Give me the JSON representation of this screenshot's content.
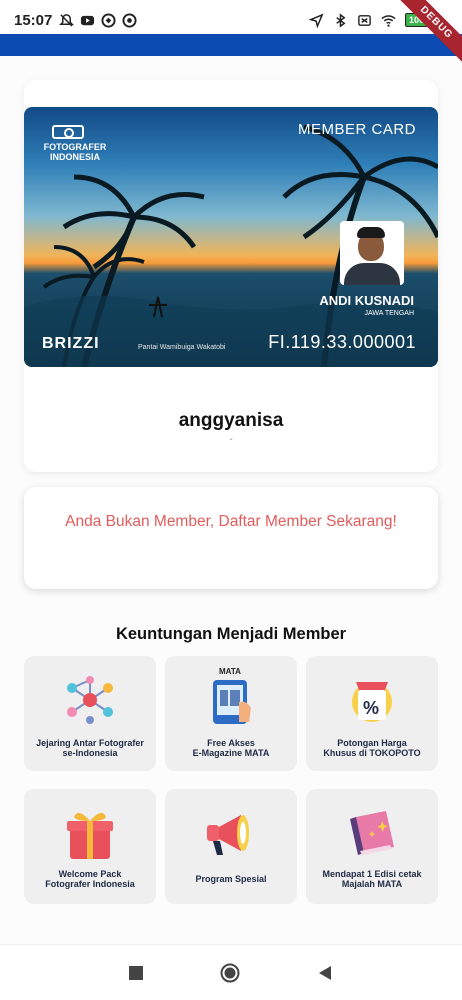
{
  "status_bar": {
    "time": "15:07",
    "battery": "100"
  },
  "debug_ribbon": "DEBUG",
  "member_card": {
    "org_logo": "FOTOGRAFER INDONESIA",
    "title": "MEMBER CARD",
    "holder_name": "ANDI KUSNADI",
    "holder_region": "JAWA TENGAH",
    "brand": "BRIZZI",
    "photo_caption": "Pantai Wamibuiga Wakatobi",
    "number": "FI.119.33.000001"
  },
  "profile": {
    "username": "anggyanisa",
    "subtitle": "-"
  },
  "notice": {
    "text": "Anda Bukan Member, Daftar Member Sekarang!"
  },
  "benefits": {
    "title": "Keuntungan Menjadi Member",
    "items": [
      {
        "line1": "Jejaring Antar Fotografer",
        "line2": "se-Indonesia",
        "icon": "network-icon"
      },
      {
        "line1": "Free Akses",
        "line2": "E-Magazine MATA",
        "icon": "magazine-icon",
        "badge": "MATA"
      },
      {
        "line1": "Potongan Harga",
        "line2": "Khusus di TOKOPOTO",
        "icon": "discount-icon"
      },
      {
        "line1": "Welcome Pack",
        "line2": "Fotografer Indonesia",
        "icon": "gift-icon"
      },
      {
        "line1": "Program Spesial",
        "line2": "",
        "icon": "megaphone-icon"
      },
      {
        "line1": "Mendapat 1 Edisi cetak",
        "line2": "Majalah MATA",
        "icon": "book-icon"
      }
    ]
  },
  "colors": {
    "app_bar": "#0b4ab0",
    "notice_text": "#e25c5c",
    "tile_bg": "#efefef"
  }
}
